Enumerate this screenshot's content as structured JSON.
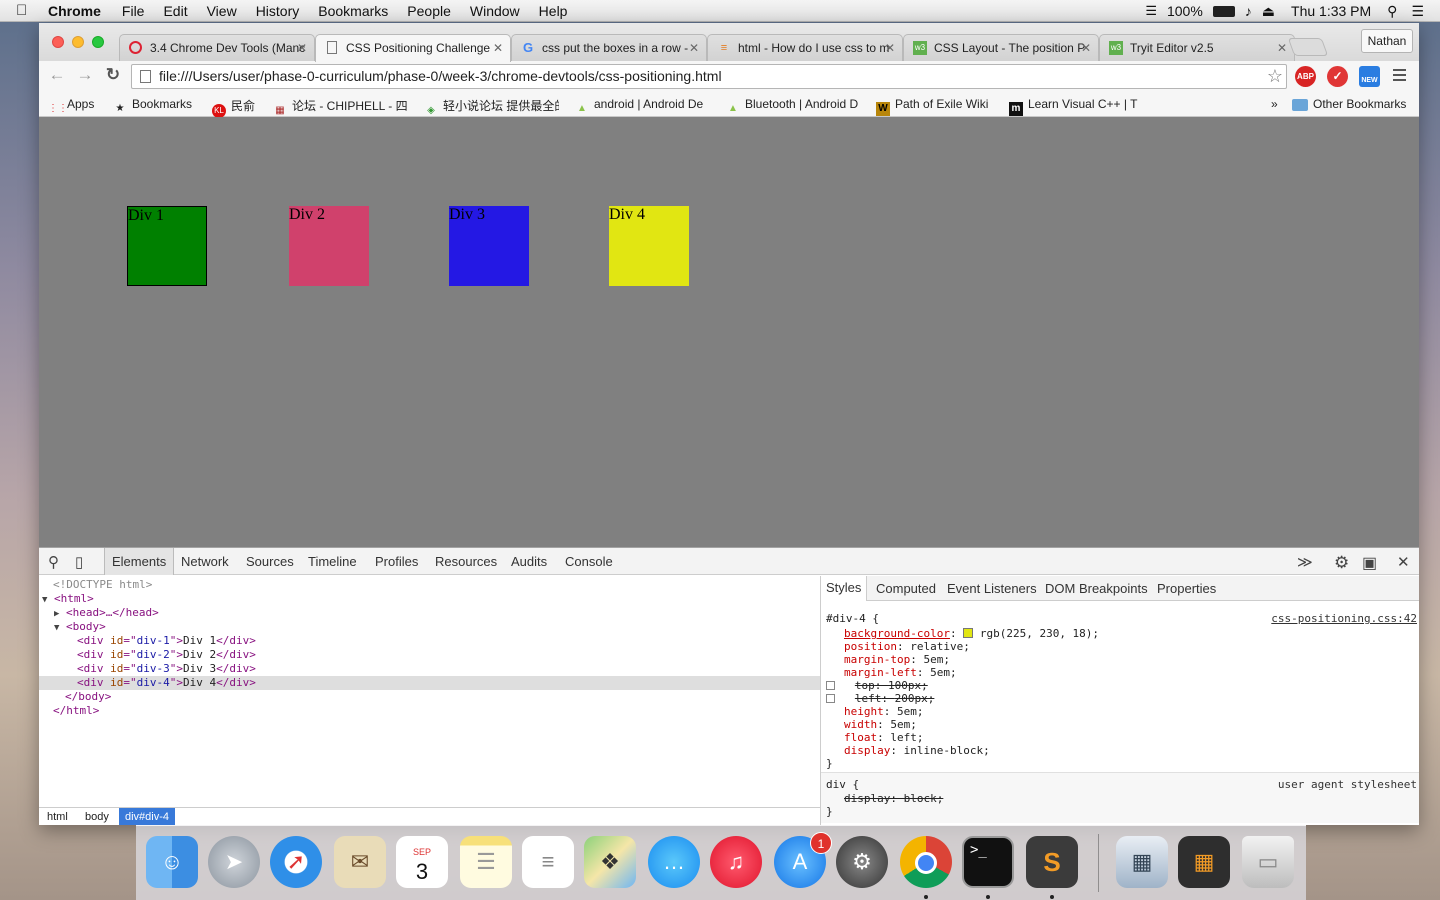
{
  "menubar": {
    "app": "Chrome",
    "items": [
      "File",
      "Edit",
      "View",
      "History",
      "Bookmarks",
      "People",
      "Window",
      "Help"
    ],
    "battery": "100%",
    "clock": "Thu 1:33 PM"
  },
  "browser": {
    "profile": "Nathan",
    "tabs": [
      {
        "title": "3.4 Chrome Dev Tools (Manc",
        "icon": "dbc-icon"
      },
      {
        "title": "CSS Positioning Challenge",
        "icon": "page-icon"
      },
      {
        "title": "css put the boxes in a row -",
        "icon": "google-icon"
      },
      {
        "title": "html - How do I use css to m",
        "icon": "stackoverflow-icon"
      },
      {
        "title": "CSS Layout - The position P",
        "icon": "w3schools-icon"
      },
      {
        "title": "Tryit Editor v2.5",
        "icon": "w3schools-icon"
      }
    ],
    "url": "file:///Users/user/phase-0-curriculum/phase-0/week-3/chrome-devtools/css-positioning.html",
    "extensions": [
      "ABP",
      "NEW"
    ],
    "bookmarks": [
      {
        "label": "Apps"
      },
      {
        "label": "Bookmarks"
      },
      {
        "label": "民俞"
      },
      {
        "label": "论坛 - CHIPHELL - 四"
      },
      {
        "label": "轻小说论坛 提供最全的"
      },
      {
        "label": "android | Android De"
      },
      {
        "label": "Bluetooth | Android D"
      },
      {
        "label": "Path of Exile Wiki"
      },
      {
        "label": "Learn Visual C++ | T"
      }
    ],
    "bookmarks_more": "»",
    "other_bookmarks": "Other Bookmarks"
  },
  "page": {
    "background": "#808080",
    "boxes": [
      {
        "label": "Div 1",
        "color": "#008000"
      },
      {
        "label": "Div 2",
        "color": "#d0416c"
      },
      {
        "label": "Div 3",
        "color": "#2418e4"
      },
      {
        "label": "Div 4",
        "color": "#e1e612"
      }
    ]
  },
  "devtools": {
    "tabs": [
      "Elements",
      "Network",
      "Sources",
      "Timeline",
      "Profiles",
      "Resources",
      "Audits",
      "Console"
    ],
    "active_tab": "Elements",
    "dom": {
      "doctype": "<!DOCTYPE html>",
      "html_open": "<html>",
      "head": "<head>…</head>",
      "body_open": "<body>",
      "divs": [
        {
          "id": "div-1",
          "text": "Div 1"
        },
        {
          "id": "div-2",
          "text": "Div 2"
        },
        {
          "id": "div-3",
          "text": "Div 3"
        },
        {
          "id": "div-4",
          "text": "Div 4"
        }
      ],
      "body_close": "</body>",
      "html_close": "</html>"
    },
    "breadcrumbs": [
      "html",
      "body",
      "div#div-4"
    ],
    "styles_tabs": [
      "Styles",
      "Computed",
      "Event Listeners",
      "DOM Breakpoints",
      "Properties"
    ],
    "rule": {
      "selector": "#div-4 {",
      "source": "css-positioning.css:42",
      "declarations": [
        {
          "prop": "background-color",
          "value": "rgb(225, 230, 18);",
          "swatch": "#e1e612",
          "struck": false,
          "checkbox": false
        },
        {
          "prop": "position",
          "value": "relative;",
          "struck": false,
          "checkbox": false
        },
        {
          "prop": "margin-top",
          "value": "5em;",
          "struck": false,
          "checkbox": false
        },
        {
          "prop": "margin-left",
          "value": "5em;",
          "struck": false,
          "checkbox": false
        },
        {
          "prop": "top",
          "value": "100px;",
          "struck": true,
          "checkbox": true
        },
        {
          "prop": "left",
          "value": "200px;",
          "struck": true,
          "checkbox": true
        },
        {
          "prop": "height",
          "value": "5em;",
          "struck": false,
          "checkbox": false
        },
        {
          "prop": "width",
          "value": "5em;",
          "struck": false,
          "checkbox": false
        },
        {
          "prop": "float",
          "value": "left;",
          "struck": false,
          "checkbox": false
        },
        {
          "prop": "display",
          "value": "inline-block;",
          "struck": false,
          "checkbox": false
        }
      ],
      "close": "}"
    },
    "ua_rule": {
      "selector": "div {",
      "source": "user agent stylesheet",
      "decl": "display: block;",
      "close": "}"
    }
  },
  "dock": {
    "calendar_month": "SEP",
    "calendar_day": "3",
    "appstore_badge": "1",
    "apps": [
      "finder-icon",
      "launchpad-icon",
      "safari-icon",
      "mail-icon",
      "calendar-icon",
      "notes-icon",
      "reminders-icon",
      "maps-icon",
      "messages-icon",
      "itunes-icon",
      "app-store-icon",
      "system-preferences-icon",
      "chrome-icon",
      "terminal-icon",
      "sublime-text-icon",
      "preview-icon",
      "downloads-icon",
      "trash-icon"
    ]
  }
}
